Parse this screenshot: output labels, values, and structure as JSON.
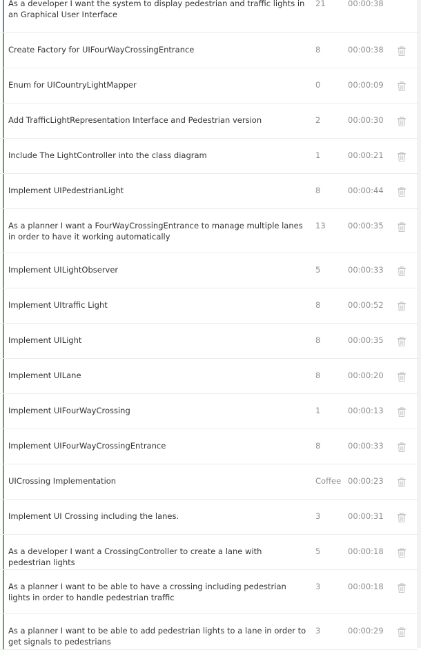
{
  "colors": {
    "accent_blue": "#3b8fd9",
    "accent_green": "#3dbb3d",
    "muted_text": "#8f8f8f",
    "trash_icon": "#c7c7c7"
  },
  "rows": [
    {
      "title": "As a developer I want the system to display pedestrian and traffic lights in an Graphical User Interface",
      "points": "21",
      "time": "00:00:38",
      "bar": "blue",
      "trash": false
    },
    {
      "title": "Create Factory for UIFourWayCrossingEntrance",
      "points": "8",
      "time": "00:00:38",
      "bar": "green",
      "trash": true
    },
    {
      "title": "Enum for UICountryLightMapper",
      "points": "0",
      "time": "00:00:09",
      "bar": "green",
      "trash": true
    },
    {
      "title": "Add TrafficLightRepresentation Interface and Pedestrian version",
      "points": "2",
      "time": "00:00:30",
      "bar": "green",
      "trash": true
    },
    {
      "title": "Include The LightController into the class diagram",
      "points": "1",
      "time": "00:00:21",
      "bar": "green",
      "trash": true
    },
    {
      "title": "Implement UIPedestrianLight",
      "points": "8",
      "time": "00:00:44",
      "bar": "green",
      "trash": true
    },
    {
      "title": "As a planner I want a FourWayCrossingEntrance to manage multiple lanes in order to have it working automatically",
      "points": "13",
      "time": "00:00:35",
      "bar": "green",
      "trash": true
    },
    {
      "title": "Implement UILightObserver",
      "points": "5",
      "time": "00:00:33",
      "bar": "green",
      "trash": true
    },
    {
      "title": "Implement UItraffic Light",
      "points": "8",
      "time": "00:00:52",
      "bar": "green",
      "trash": true
    },
    {
      "title": "Implement UILight",
      "points": "8",
      "time": "00:00:35",
      "bar": "green",
      "trash": true
    },
    {
      "title": "Implement UILane",
      "points": "8",
      "time": "00:00:20",
      "bar": "green",
      "trash": true
    },
    {
      "title": "Implement UIFourWayCrossing",
      "points": "1",
      "time": "00:00:13",
      "bar": "green",
      "trash": true
    },
    {
      "title": "Implement UIFourWayCrossingEntrance",
      "points": "8",
      "time": "00:00:33",
      "bar": "green",
      "trash": true
    },
    {
      "title": "UICrossing Implementation",
      "points": "Coffee",
      "time": "00:00:23",
      "bar": "green",
      "trash": true
    },
    {
      "title": "Implement UI Crossing including the lanes.",
      "points": "3",
      "time": "00:00:31",
      "bar": "green",
      "trash": true
    },
    {
      "title": "As a developer I want a CrossingController to create a lane with pedestrian lights",
      "points": "5",
      "time": "00:00:18",
      "bar": "green",
      "trash": true
    },
    {
      "title": "As a planner I want to be able to have a crossing including pedestrian lights in order to handle pedestrian traffic",
      "points": "3",
      "time": "00:00:18",
      "bar": "green",
      "trash": true
    },
    {
      "title": "As a planner I want to be able to add pedestrian lights to a lane in order to get signals to pedestrians",
      "points": "3",
      "time": "00:00:29",
      "bar": "green",
      "trash": true
    }
  ]
}
